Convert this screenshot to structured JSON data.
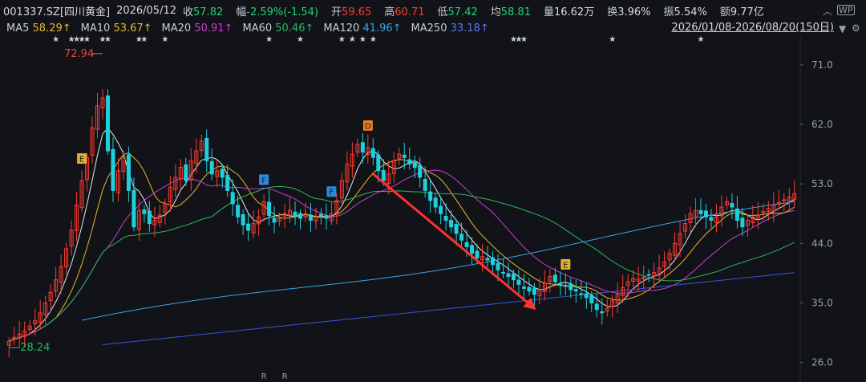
{
  "header": {
    "code": "001337.SZ[四川黄金]",
    "date": "2026/05/12",
    "close_label": "收",
    "close": "57.82",
    "change_label": "幅",
    "change": "-2.59%(-1.54)",
    "open_label": "开",
    "open": "59.65",
    "high_label": "高",
    "high": "60.71",
    "low_label": "低",
    "low": "57.42",
    "avg_label": "均",
    "avg": "58.81",
    "volume_label": "量",
    "volume": "16.62万",
    "turnover_label": "换",
    "turnover": "3.96%",
    "amplitude_label": "振",
    "amplitude": "5.54%",
    "amount_label": "额",
    "amount": "9.77亿"
  },
  "ma_bar": {
    "ma5_label": "MA5",
    "ma5": "58.29↑",
    "ma10_label": "MA10",
    "ma10": "53.67↑",
    "ma20_label": "MA20",
    "ma20": "50.91↑",
    "ma60_label": "MA60",
    "ma60": "50.46↑",
    "ma120_label": "MA120",
    "ma120": "41.96↑",
    "ma250_label": "MA250",
    "ma250": "33.18↑",
    "range": "2026/01/08-2026/08/20(150日)"
  },
  "icons": {
    "settings": "gear-icon",
    "dropdown": "triangle-down-icon",
    "expand": "chevron-up-icon",
    "close": "close-icon",
    "wp": "WP"
  },
  "colors": {
    "up": "#ff3b30",
    "down": "#1ecfdc",
    "ma5": "#e8e8e8",
    "ma10": "#e8b82a",
    "ma20": "#c93fd0",
    "ma60": "#2bb85a",
    "ma120": "#3aa0e8",
    "ma250": "#3b55d6",
    "arrow": "#ff3030",
    "marker_e": "#e0b030",
    "marker_d": "#f07a20",
    "marker_f": "#2a8ae0"
  },
  "chart_data": {
    "type": "candlestick",
    "ylim": [
      24.5,
      74.5
    ],
    "yticks": [
      "71.0",
      "62.0",
      "53.0",
      "44.0",
      "35.0",
      "26.0"
    ],
    "ytick_values": [
      71,
      62,
      53,
      44,
      35,
      26
    ],
    "annotations": {
      "high_value": "72.94",
      "low_value": "28.24"
    },
    "markers": [
      {
        "label": "E",
        "index": 14
      },
      {
        "label": "F",
        "index": 49
      },
      {
        "label": "F",
        "index": 62
      },
      {
        "label": "D",
        "index": 69
      },
      {
        "label": "E",
        "index": 107
      }
    ],
    "stars_at": [
      9,
      12,
      13,
      14,
      15,
      18,
      19,
      25,
      26,
      30,
      50,
      56,
      64,
      66,
      68,
      70,
      97,
      98,
      99,
      116,
      133
    ],
    "bottom_labels": [
      {
        "label": "R",
        "index": 49
      },
      {
        "label": "R",
        "index": 53
      }
    ],
    "closes": [
      29.2,
      29.8,
      30.3,
      30.8,
      31.5,
      32.3,
      33.5,
      35,
      36.6,
      38.5,
      40.5,
      43.2,
      46,
      49.8,
      53.5,
      57,
      61.5,
      64.8,
      66,
      58,
      52,
      55,
      57,
      52,
      46.5,
      49,
      48.5,
      47,
      47.5,
      48.3,
      50,
      52.5,
      54,
      55.5,
      53.5,
      56.5,
      58,
      59.5,
      56.5,
      54.5,
      55,
      54,
      52,
      50,
      48,
      46.8,
      46,
      47,
      48,
      50.3,
      48.2,
      47.2,
      47.8,
      48.5,
      49,
      48.2,
      47.8,
      48.5,
      47.5,
      48,
      48.2,
      47.8,
      48.5,
      50.5,
      53.5,
      56,
      57.5,
      59,
      57.8,
      58.5,
      57,
      55,
      53.5,
      54.5,
      56.5,
      57.5,
      57,
      56,
      55.5,
      54,
      52,
      50.5,
      49.5,
      48.5,
      47.5,
      46.5,
      45.5,
      44.5,
      43.5,
      42.5,
      41.8,
      42,
      41.5,
      40.8,
      40,
      39.5,
      39,
      38.5,
      37.8,
      37.2,
      36.8,
      36.3,
      37,
      38,
      39,
      38.2,
      37.8,
      37.5,
      37,
      36.8,
      36.3,
      35.8,
      35,
      34,
      33.5,
      34.2,
      35.3,
      36.3,
      37.3,
      38.2,
      38.7,
      38.6,
      38.9,
      39.2,
      39.6,
      40.3,
      41.2,
      42.5,
      44,
      45.5,
      47,
      48.5,
      49,
      48.5,
      48,
      47.5,
      48,
      49.5,
      50.3,
      49.5,
      47.5,
      46.5,
      47.5,
      48,
      48.3,
      48.8,
      49.3,
      49.8,
      50.2,
      50.6,
      51,
      51.5
    ],
    "ma_series": [
      "MA5",
      "MA10",
      "MA20",
      "MA60",
      "MA120",
      "MA250"
    ]
  }
}
